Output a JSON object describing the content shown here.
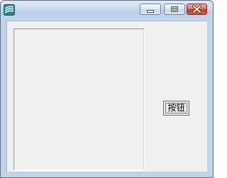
{
  "window": {
    "title": "",
    "icon": "app-icon",
    "controls": {
      "minimize_icon": "minimize-icon",
      "maximize_icon": "maximize-icon",
      "close_icon": "close-icon"
    }
  },
  "content": {
    "button_label": "按钮"
  },
  "colors": {
    "client_background": "#f0f0f0",
    "close_button": "#c0392b",
    "titlebar": "#c9d9ec"
  }
}
